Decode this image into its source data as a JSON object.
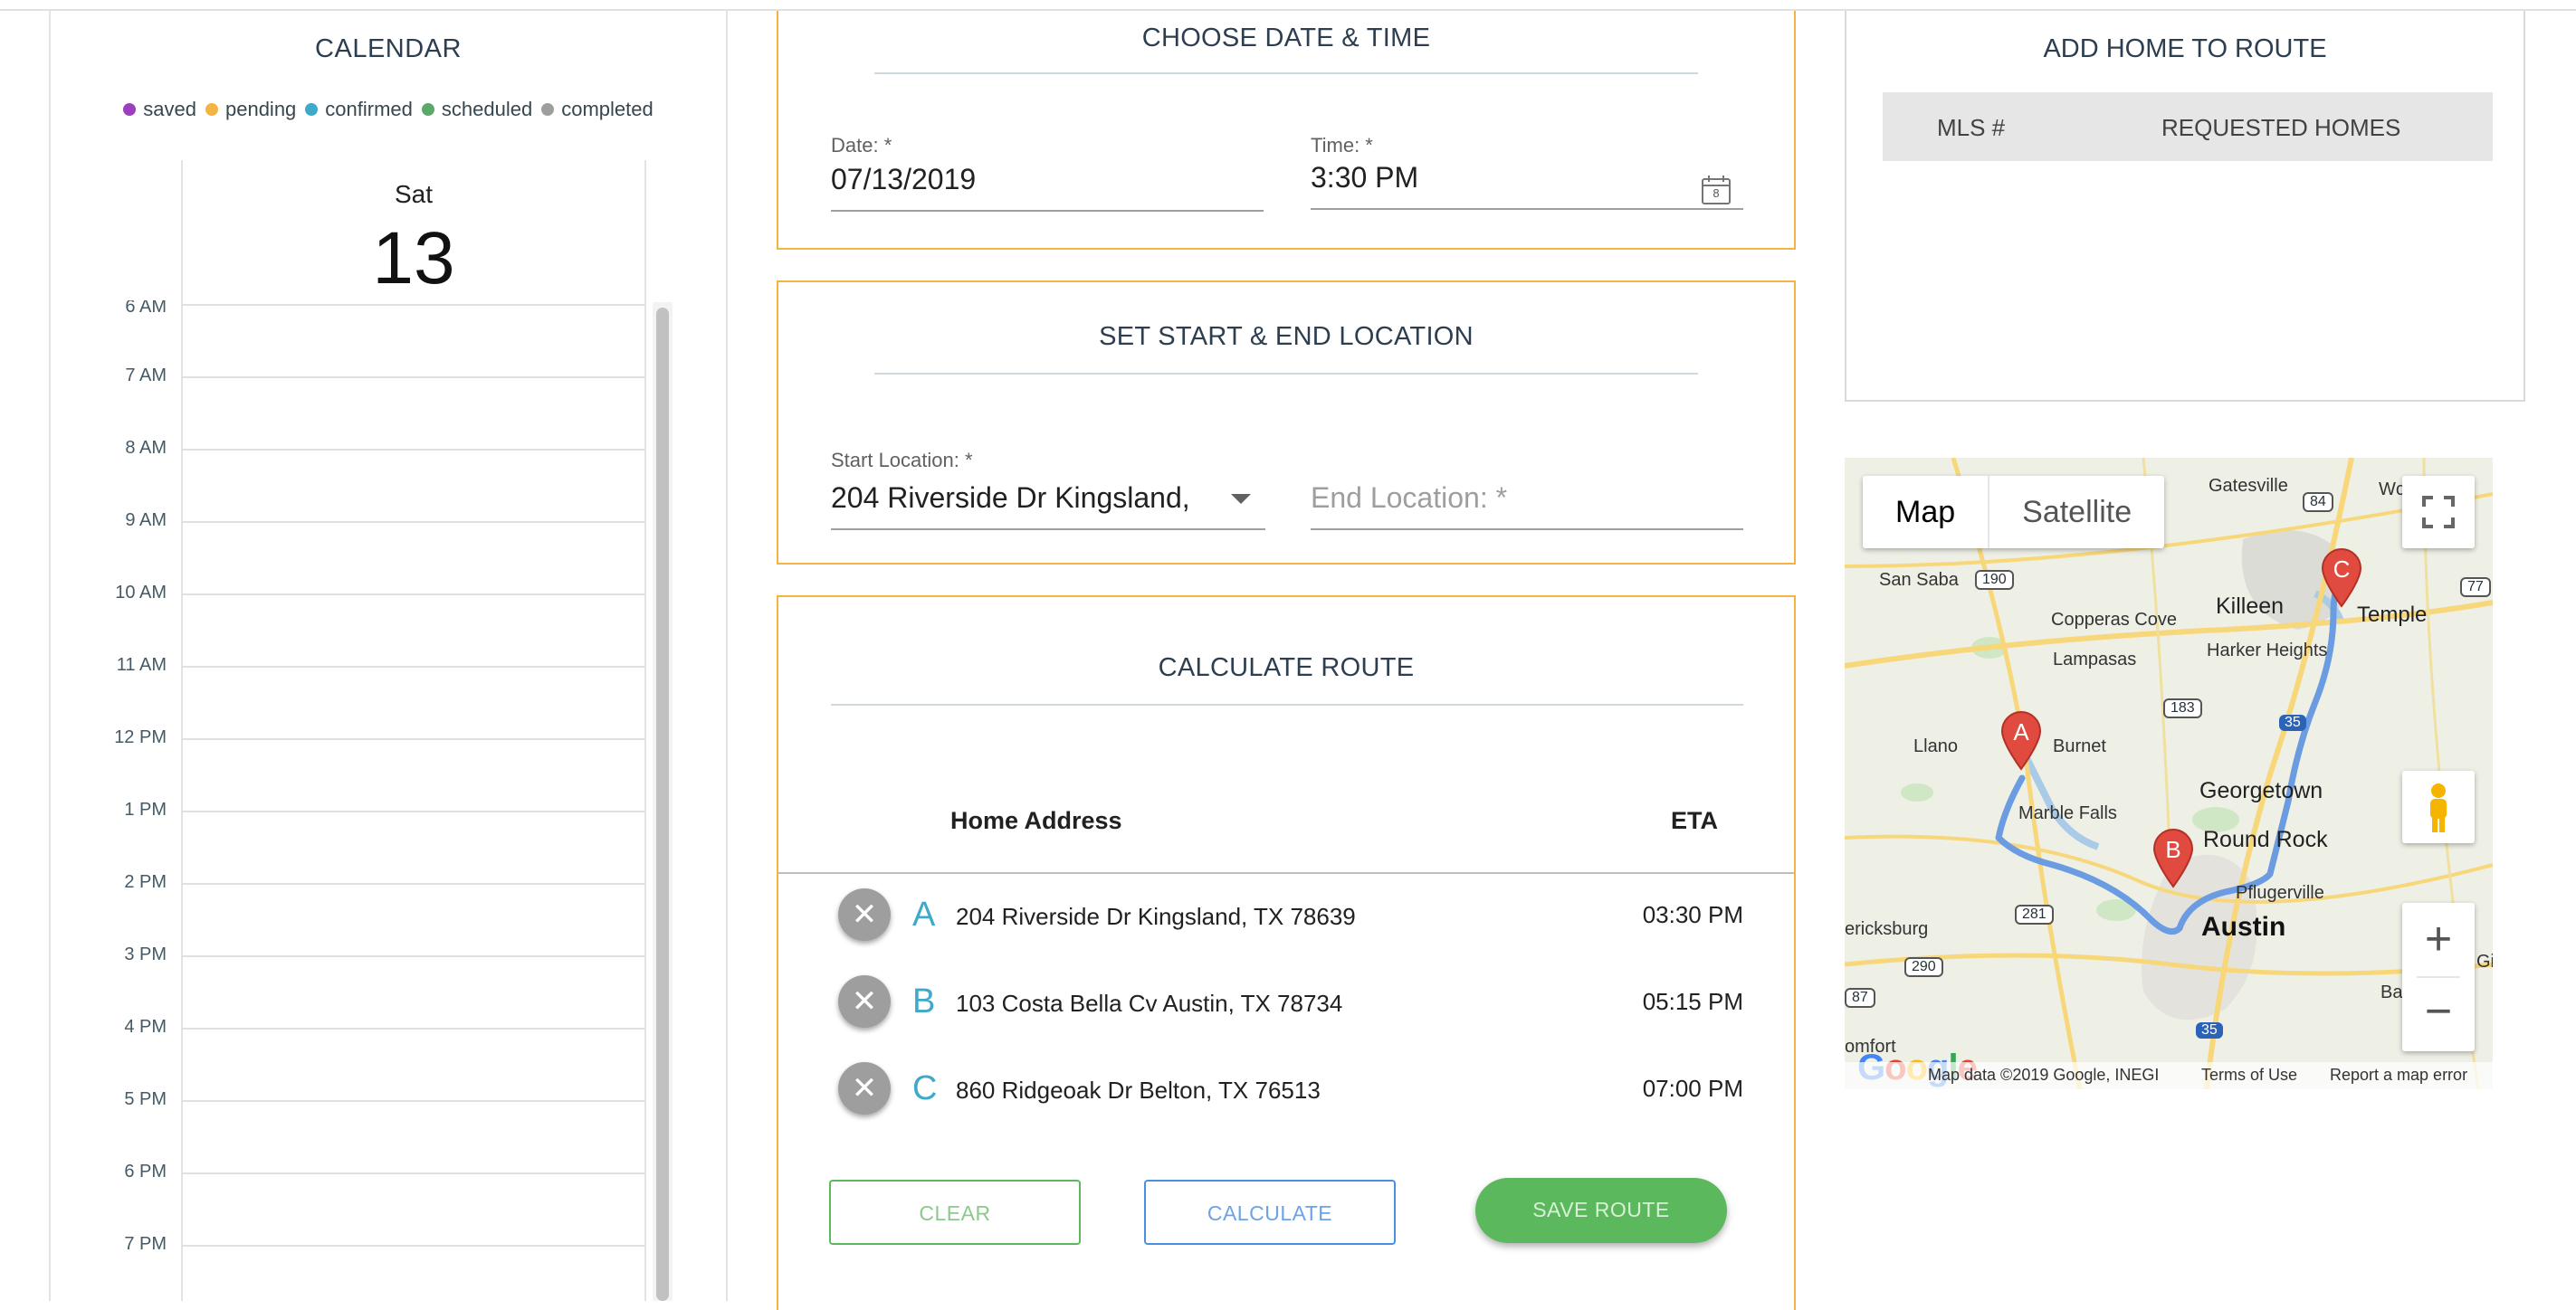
{
  "calendar": {
    "title": "CALENDAR",
    "legend": [
      {
        "label": "saved",
        "color": "#9b3fbf"
      },
      {
        "label": "pending",
        "color": "#f5b342"
      },
      {
        "label": "confirmed",
        "color": "#3fa9c9"
      },
      {
        "label": "scheduled",
        "color": "#5aa86a"
      },
      {
        "label": "completed",
        "color": "#9e9e9e"
      }
    ],
    "day_name": "Sat",
    "day_number": "13",
    "partial_label": "6 AM",
    "hours": [
      "7 AM",
      "8 AM",
      "9 AM",
      "10 AM",
      "11 AM",
      "12 PM",
      "1 PM",
      "2 PM",
      "3 PM",
      "4 PM",
      "5 PM",
      "6 PM",
      "7 PM"
    ]
  },
  "date_time": {
    "title": "CHOOSE DATE & TIME",
    "date_label": "Date: *",
    "date_value": "07/13/2019",
    "time_label": "Time: *",
    "time_value": "3:30 PM",
    "calendar_icon_day": "8"
  },
  "location": {
    "title": "SET START & END LOCATION",
    "start_label": "Start Location: *",
    "start_value": "204  Riverside Dr   Kingsland, ",
    "end_placeholder": "End Location: *"
  },
  "route": {
    "title": "CALCULATE ROUTE",
    "col_address": "Home Address",
    "col_eta": "ETA",
    "stops": [
      {
        "letter": "A",
        "address": "204 Riverside Dr Kingsland, TX 78639",
        "eta": "03:30 PM"
      },
      {
        "letter": "B",
        "address": "103 Costa Bella Cv Austin, TX 78734",
        "eta": "05:15 PM"
      },
      {
        "letter": "C",
        "address": "860 Ridgeoak Dr Belton, TX 76513",
        "eta": "07:00 PM"
      }
    ],
    "remove_glyph": "✕",
    "clear_label": "CLEAR",
    "calculate_label": "CALCULATE",
    "save_label": "SAVE ROUTE"
  },
  "add_home": {
    "title": "ADD HOME TO ROUTE",
    "col_mls": "MLS #",
    "col_requested": "REQUESTED HOMES"
  },
  "map": {
    "type_map": "Map",
    "type_satellite": "Satellite",
    "zoom_in": "+",
    "zoom_out": "−",
    "attribution": "Map data ©2019 Google, INEGI",
    "terms": "Terms of Use",
    "report": "Report a map error",
    "google_logo": "Google",
    "cities": [
      {
        "name": "Gatesville"
      },
      {
        "name": "San Saba"
      },
      {
        "name": "Killeen"
      },
      {
        "name": "Temple"
      },
      {
        "name": "Copperas Cove"
      },
      {
        "name": "Harker Heights"
      },
      {
        "name": "Lampasas"
      },
      {
        "name": "Llano"
      },
      {
        "name": "Burnet"
      },
      {
        "name": "Georgetown"
      },
      {
        "name": "Marble Falls"
      },
      {
        "name": "Round Rock"
      },
      {
        "name": "Pflugerville"
      },
      {
        "name": "Austin"
      },
      {
        "name": "ericksburg"
      },
      {
        "name": "Bastro"
      },
      {
        "name": "omfort"
      },
      {
        "name": "Wc"
      },
      {
        "name": "Gi"
      }
    ],
    "highway_shields": [
      "84",
      "190",
      "77",
      "183",
      "35",
      "281",
      "290",
      "87",
      "35"
    ],
    "markers": [
      "A",
      "B",
      "C"
    ],
    "colors": {
      "route": "#6b9be0",
      "marker": "#e04a3f",
      "highway": "#f7d77a",
      "water": "#a9cbe8"
    }
  }
}
